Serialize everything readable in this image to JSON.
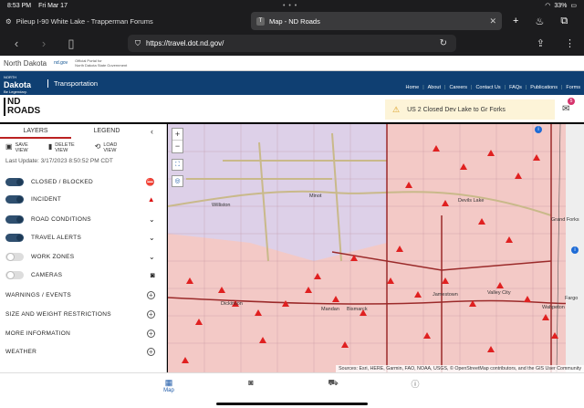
{
  "status_bar": {
    "time": "8:53 PM",
    "date": "Fri Mar 17",
    "dots": "• • •",
    "battery": "33%"
  },
  "browser": {
    "tabs": [
      {
        "title": "Pileup I-90 White Lake - Trapperman Forums",
        "favicon": "gear-icon"
      },
      {
        "title": "Map - ND Roads",
        "favicon_text": "T"
      }
    ],
    "url": "https://travel.dot.nd.gov/"
  },
  "state_header": {
    "state_name": "North Dakota",
    "gov_link": "nd.gov",
    "gov_desc_line1": "Official Portal for",
    "gov_desc_line2": "North Dakota State Government"
  },
  "banner": {
    "logo_top": "NORTH",
    "logo_main": "Dakota",
    "logo_sub": "Be Legendary.",
    "department": "Transportation",
    "menu": [
      "Home",
      "About",
      "Careers",
      "Contact Us",
      "FAQs",
      "Publications",
      "Forms"
    ]
  },
  "app": {
    "logo_line1": "ND",
    "logo_line2": "ROADS",
    "alert_text": "US 2 Closed Dev Lake to Gr Forks",
    "notification_count": "5"
  },
  "sidebar": {
    "tabs": [
      "LAYERS",
      "LEGEND"
    ],
    "tools": [
      {
        "label1": "SAVE",
        "label2": "VIEW"
      },
      {
        "label1": "DELETE",
        "label2": "VIEW"
      },
      {
        "label1": "LOAD",
        "label2": "VIEW"
      }
    ],
    "last_update": "Last Update: 3/17/2023 8:50:52 PM CDT",
    "layers": [
      {
        "label": "CLOSED / BLOCKED",
        "on": true,
        "icon": "closed-icon"
      },
      {
        "label": "INCIDENT",
        "on": true,
        "icon": "warning-icon"
      },
      {
        "label": "ROAD CONDITIONS",
        "on": true,
        "icon": "chevron-down-icon"
      },
      {
        "label": "TRAVEL ALERTS",
        "on": true,
        "icon": "chevron-down-icon"
      },
      {
        "label": "WORK ZONES",
        "on": false,
        "icon": "chevron-down-icon"
      },
      {
        "label": "CAMERAS",
        "on": false,
        "icon": "camera-icon"
      }
    ],
    "sections": [
      "WARNINGS / EVENTS",
      "SIZE AND WEIGHT RESTRICTIONS",
      "MORE INFORMATION",
      "WEATHER"
    ]
  },
  "map": {
    "zoom_in": "+",
    "zoom_out": "−",
    "cities": [
      "Williston",
      "Minot",
      "Devils Lake",
      "Grand Forks",
      "Jamestown",
      "Valley City",
      "Fargo",
      "Dickinson",
      "Mandan",
      "Bismarck",
      "Wahpeton"
    ],
    "attribution": "Sources: Esri, HERE, Garmin, FAO, NOAA, USGS, © OpenStreetMap contributors, and the GIS User Community"
  },
  "bottom_nav": {
    "items": [
      "Map",
      "",
      "",
      ""
    ]
  }
}
